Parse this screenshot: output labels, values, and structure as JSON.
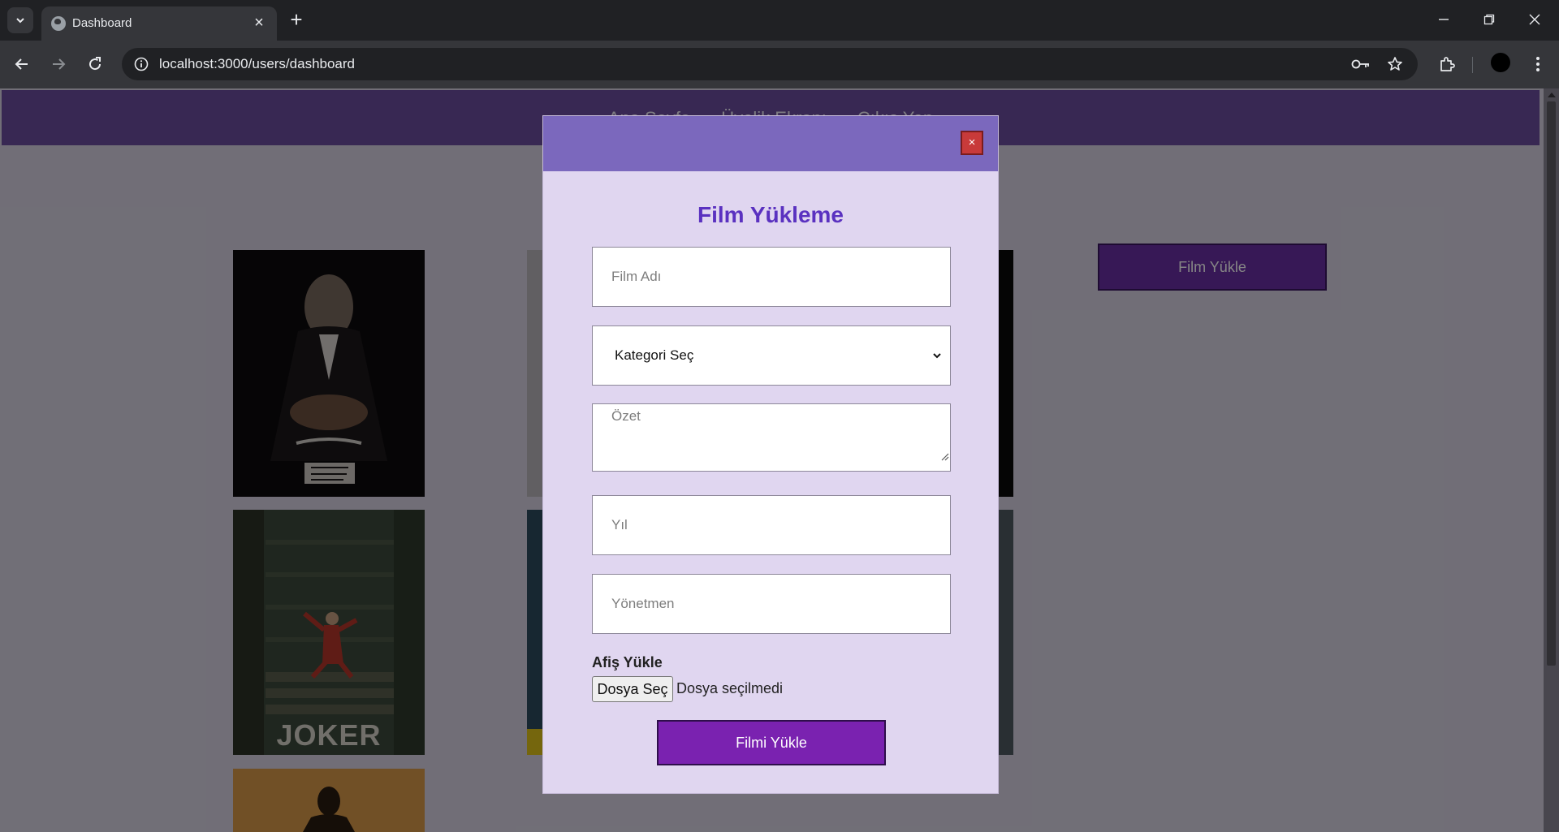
{
  "browser": {
    "tab_title": "Dashboard",
    "url": "localhost:3000/users/dashboard",
    "icons": [
      "tab-search-icon",
      "globe-icon",
      "close-icon",
      "plus-icon",
      "minimize-icon",
      "restore-icon",
      "window-close-icon",
      "back-icon",
      "forward-icon",
      "reload-icon",
      "site-info-icon",
      "password-key-icon",
      "star-icon",
      "extensions-icon",
      "menu-icon"
    ]
  },
  "site_nav": {
    "links": [
      "Ana Sayfa",
      "Üyelik Ekranı",
      "Çıkış Yap"
    ]
  },
  "main": {
    "upload_button_label": "Film Yükle"
  },
  "modal": {
    "close_label": "×",
    "title": "Film Yükleme",
    "film_name_placeholder": "Film Adı",
    "category_selected": "Kategori Seç",
    "summary_placeholder": "Özet",
    "year_placeholder": "Yıl",
    "director_placeholder": "Yönetmen",
    "poster_label": "Afiş Yükle",
    "file_button_label": "Dosya Seç",
    "file_status": "Dosya seçilmedi",
    "submit_label": "Filmi Yükle"
  },
  "colors": {
    "nav_bg": "#6b4ea0",
    "modal_header": "#7b68bd",
    "modal_bg": "#e0d6f0",
    "title_color": "#5a31c0",
    "submit_bg": "#7a22b0",
    "close_bg": "#c83a3a"
  }
}
